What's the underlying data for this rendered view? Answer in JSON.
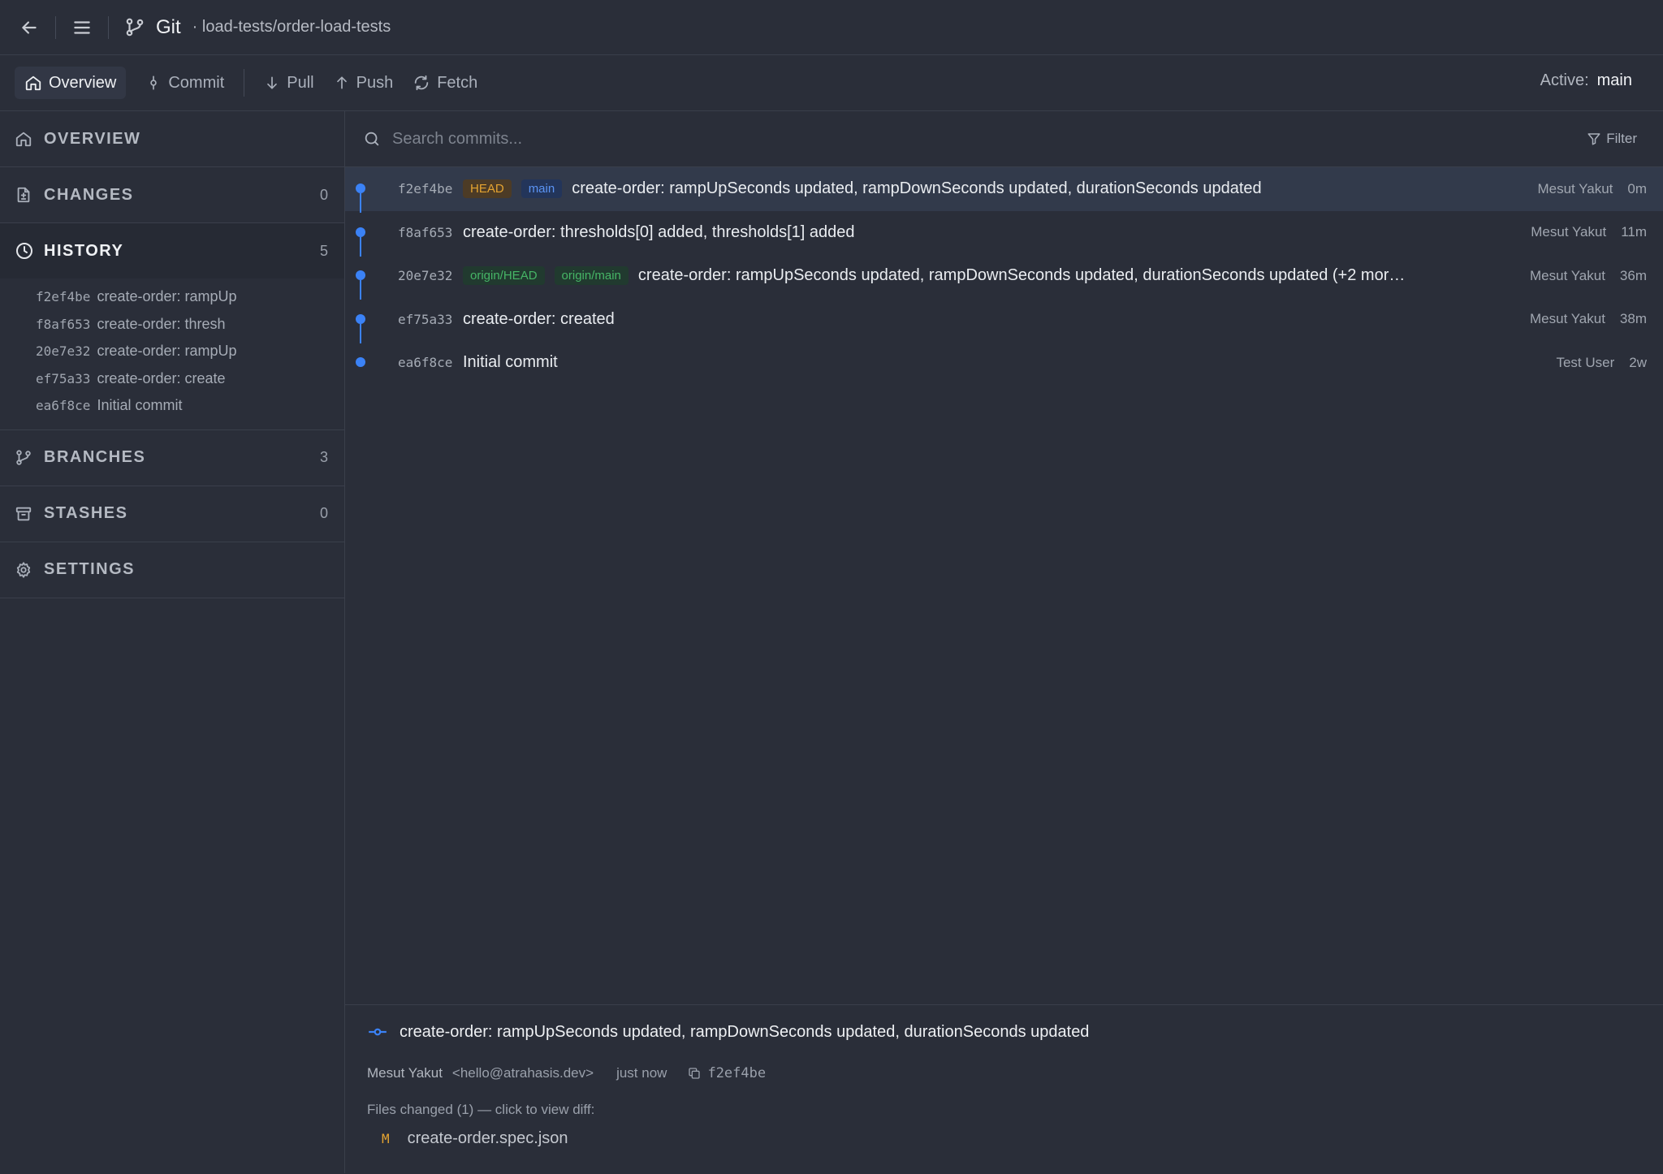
{
  "titlebar": {
    "title": "Git",
    "path": "· load-tests/order-load-tests"
  },
  "toolbar": {
    "overview": "Overview",
    "commit": "Commit",
    "pull": "Pull",
    "push": "Push",
    "fetch": "Fetch",
    "active_label": "Active:",
    "active_branch": "main"
  },
  "sidebar": {
    "overview": {
      "label": "OVERVIEW"
    },
    "changes": {
      "label": "CHANGES",
      "count": "0"
    },
    "history": {
      "label": "HISTORY",
      "count": "5",
      "items": [
        {
          "hash": "f2ef4be",
          "msg": "create-order: rampUp"
        },
        {
          "hash": "f8af653",
          "msg": "create-order: thresh"
        },
        {
          "hash": "20e7e32",
          "msg": "create-order: rampUp"
        },
        {
          "hash": "ef75a33",
          "msg": "create-order: create"
        },
        {
          "hash": "ea6f8ce",
          "msg": "Initial commit"
        }
      ]
    },
    "branches": {
      "label": "BRANCHES",
      "count": "3"
    },
    "stashes": {
      "label": "STASHES",
      "count": "0"
    },
    "settings": {
      "label": "SETTINGS"
    }
  },
  "search": {
    "placeholder": "Search commits...",
    "filter": "Filter"
  },
  "commits": [
    {
      "hash": "f2ef4be",
      "badges": [
        "HEAD",
        "main"
      ],
      "msg": "create-order: rampUpSeconds updated, rampDownSeconds updated, durationSeconds updated",
      "author": "Mesut Yakut",
      "time": "0m"
    },
    {
      "hash": "f8af653",
      "badges": [],
      "msg": "create-order: thresholds[0] added, thresholds[1] added",
      "author": "Mesut Yakut",
      "time": "11m"
    },
    {
      "hash": "20e7e32",
      "badges": [
        "origin/HEAD",
        "origin/main"
      ],
      "msg": "create-order: rampUpSeconds updated, rampDownSeconds updated, durationSeconds updated (+2 mor…",
      "author": "Mesut Yakut",
      "time": "36m"
    },
    {
      "hash": "ef75a33",
      "badges": [],
      "msg": "create-order: created",
      "author": "Mesut Yakut",
      "time": "38m"
    },
    {
      "hash": "ea6f8ce",
      "badges": [],
      "msg": "Initial commit",
      "author": "Test User",
      "time": "2w"
    }
  ],
  "details": {
    "title": "create-order: rampUpSeconds updated, rampDownSeconds updated, durationSeconds updated",
    "author": "Mesut Yakut",
    "email": "<hello@atrahasis.dev>",
    "when": "just now",
    "hash": "f2ef4be",
    "files_label": "Files changed (1) — click to view diff:",
    "files": [
      {
        "status": "M",
        "name": "create-order.spec.json"
      }
    ]
  },
  "colors": {
    "accent": "#3b82f6",
    "head_badge": "#e5a431",
    "remote_badge": "#46b566",
    "background": "#2a2e39"
  }
}
